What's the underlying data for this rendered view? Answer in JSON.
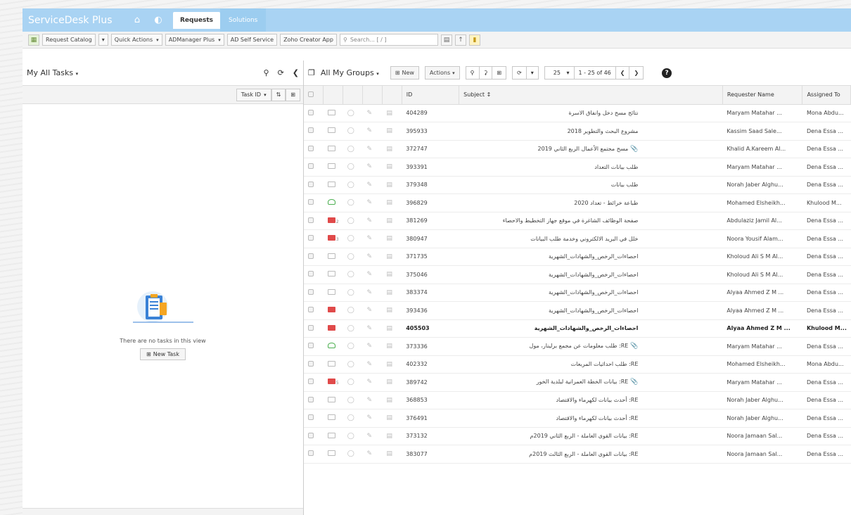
{
  "header": {
    "logo": "ServiceDesk Plus",
    "tabs": [
      {
        "label": "Requests"
      },
      {
        "label": "Solutions"
      }
    ]
  },
  "toolbar": {
    "request_catalog": "Request Catalog",
    "quick_actions": "Quick Actions",
    "admanager": "ADManager Plus",
    "ad_self_service": "AD Self Service",
    "zoho_creator": "Zoho Creator App",
    "search_placeholder": "Search... [ / ]"
  },
  "tasks_pane": {
    "title": "My All Tasks",
    "sort_label": "Task ID",
    "empty_text": "There are no tasks in this view",
    "new_task": "New Task"
  },
  "requests_pane": {
    "title": "All My Groups",
    "new_label": "New",
    "actions_label": "Actions",
    "page_size": "25",
    "range": "1 - 25 of 46",
    "columns": {
      "id": "ID",
      "subject": "Subject",
      "requester": "Requester Name",
      "assigned": "Assigned To"
    },
    "rows": [
      {
        "id": "404289",
        "subject": "نتائج مسح دخل وانفاق الاسرة",
        "requester": "Maryam Matahar ...",
        "assigned": "Mona Abdu...",
        "mail": "normal",
        "count": "",
        "clip": false,
        "bold": false
      },
      {
        "id": "395933",
        "subject": "مشروع البحث والتطوير 2018",
        "requester": "Kassim Saad Sale...",
        "assigned": "Dena Essa ...",
        "mail": "normal",
        "count": "",
        "clip": false,
        "bold": false
      },
      {
        "id": "372747",
        "subject": "مسح مجتمع الأعمال الربع الثاني 2019",
        "requester": "Khalid A.Kareem Al...",
        "assigned": "Dena Essa ...",
        "mail": "normal",
        "count": "",
        "clip": true,
        "bold": false
      },
      {
        "id": "393391",
        "subject": "طلب بيانات التعداد",
        "requester": "Maryam Matahar ...",
        "assigned": "Dena Essa ...",
        "mail": "normal",
        "count": "",
        "clip": false,
        "bold": false
      },
      {
        "id": "379348",
        "subject": "طلب بيانات",
        "requester": "Norah Jaber Alghu...",
        "assigned": "Dena Essa ...",
        "mail": "normal",
        "count": "",
        "clip": false,
        "bold": false
      },
      {
        "id": "396829",
        "subject": "طباعة خرائط - تعداد 2020",
        "requester": "Mohamed Elsheikh...",
        "assigned": "Khulood M...",
        "mail": "green",
        "count": "",
        "clip": false,
        "bold": false
      },
      {
        "id": "381269",
        "subject": "صفحة الوظائف الشاغرة في موقع جهاز التخطيط والاحصاء",
        "requester": "Abdulaziz Jamil Al...",
        "assigned": "Dena Essa ...",
        "mail": "red",
        "count": "2",
        "clip": false,
        "bold": false
      },
      {
        "id": "380947",
        "subject": "خلل في البريد الالكتروني وخدمة طلب البيانات",
        "requester": "Noora Yousif Alam...",
        "assigned": "Dena Essa ...",
        "mail": "red",
        "count": "3",
        "clip": false,
        "bold": false
      },
      {
        "id": "371735",
        "subject": "احصاءات_الرخص_والشهادات_الشهرية",
        "requester": "Kholoud Ali S M Al...",
        "assigned": "Dena Essa ...",
        "mail": "normal",
        "count": "",
        "clip": false,
        "bold": false
      },
      {
        "id": "375046",
        "subject": "احصاءات_الرخص_والشهادات_الشهرية",
        "requester": "Kholoud Ali S M Al...",
        "assigned": "Dena Essa ...",
        "mail": "normal",
        "count": "",
        "clip": false,
        "bold": false
      },
      {
        "id": "383374",
        "subject": "احصاءات_الرخص_والشهادات_الشهرية",
        "requester": "Alyaa Ahmed Z M ...",
        "assigned": "Dena Essa ...",
        "mail": "normal",
        "count": "",
        "clip": false,
        "bold": false
      },
      {
        "id": "393436",
        "subject": "احصاءات_الرخص_والشهادات_الشهرية",
        "requester": "Alyaa Ahmed Z M ...",
        "assigned": "Dena Essa ...",
        "mail": "red",
        "count": "",
        "clip": false,
        "bold": false
      },
      {
        "id": "405503",
        "subject": "احصاءات_الرخص_والشهادات_الشهرية",
        "requester": "Alyaa Ahmed Z M ...",
        "assigned": "Khulood M...",
        "mail": "red",
        "count": "",
        "clip": false,
        "bold": true
      },
      {
        "id": "373336",
        "subject": "RE: طلب معلومات عن مجمع برلينار، مول",
        "requester": "Maryam Matahar ...",
        "assigned": "Dena Essa ...",
        "mail": "green",
        "count": "",
        "clip": true,
        "bold": false
      },
      {
        "id": "402332",
        "subject": "RE: طلب احداثيات المربعات",
        "requester": "Mohamed Elsheikh...",
        "assigned": "Mona Abdu...",
        "mail": "normal",
        "count": "",
        "clip": false,
        "bold": false
      },
      {
        "id": "389742",
        "subject": "RE: بيانات الخطة العمرانية لبلدية الخور",
        "requester": "Maryam Matahar ...",
        "assigned": "Dena Essa ...",
        "mail": "red",
        "count": "5",
        "clip": true,
        "bold": false
      },
      {
        "id": "368853",
        "subject": "RE: أحدث بيانات لكهرماء والاقتصاد",
        "requester": "Norah Jaber Alghu...",
        "assigned": "Dena Essa ...",
        "mail": "normal",
        "count": "",
        "clip": false,
        "bold": false
      },
      {
        "id": "376491",
        "subject": "RE: أحدث بيانات لكهرماء والاقتصاد",
        "requester": "Norah Jaber Alghu...",
        "assigned": "Dena Essa ...",
        "mail": "normal",
        "count": "",
        "clip": false,
        "bold": false
      },
      {
        "id": "373132",
        "subject": "RE: بيانات القوى العاملة - الربع الثاني 2019م",
        "requester": "Noora Jamaan Sal...",
        "assigned": "Dena Essa ...",
        "mail": "normal",
        "count": "",
        "clip": false,
        "bold": false
      },
      {
        "id": "383077",
        "subject": "RE: بيانات القوى العاملة - الربع الثالث 2019م",
        "requester": "Noora Jamaan Sal...",
        "assigned": "Dena Essa ...",
        "mail": "normal",
        "count": "",
        "clip": false,
        "bold": false
      }
    ]
  }
}
